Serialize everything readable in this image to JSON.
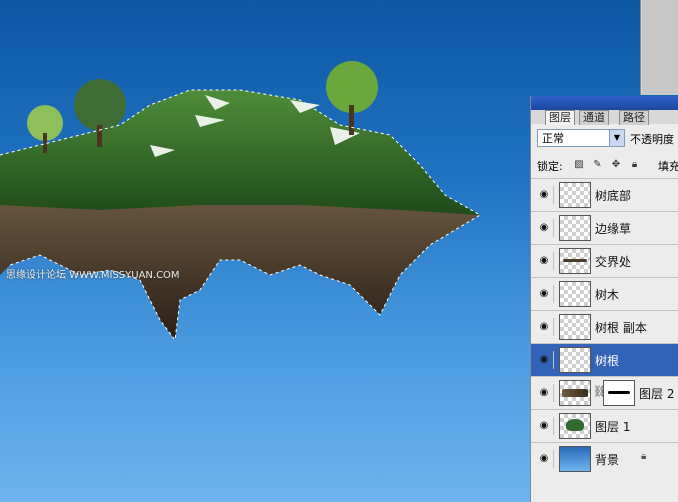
{
  "canvas": {
    "watermark": "思缘设计论坛 WWW.MISSYUAN.COM"
  },
  "panel": {
    "tabs": [
      "图层",
      "通道",
      "路径"
    ],
    "blend_mode": "正常",
    "opacity_label": "不透明度",
    "lock_label": "锁定:",
    "fill_label": "填充",
    "layers": [
      {
        "name": "树底部",
        "selected": false
      },
      {
        "name": "边缘草",
        "selected": false
      },
      {
        "name": "交界处",
        "selected": false
      },
      {
        "name": "树木",
        "selected": false
      },
      {
        "name": "树根 副本",
        "selected": false
      },
      {
        "name": "树根",
        "selected": true
      },
      {
        "name": "图层 2",
        "selected": false,
        "has_mask": true
      },
      {
        "name": "图层 1",
        "selected": false
      },
      {
        "name": "背景",
        "selected": false
      }
    ]
  }
}
